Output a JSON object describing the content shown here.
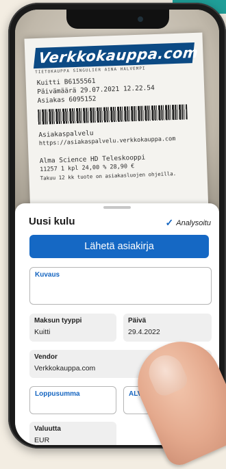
{
  "receipt": {
    "logo": "Verkkokauppa.com",
    "logo_sub": "TIETOKAUPPA SINGULIER AINA HALVEMPI",
    "lines": [
      "Kuitti        B6155561",
      "Päivämäärä    29.07.2021 12.22.54",
      "Asiakas       6095152",
      "Asiakaspalvelu",
      "https://asiakaspalvelu.verkkokauppa.com",
      "Alma Science HD Teleskooppi",
      "11257          1 kpl    24,00 %    28,90 €",
      "Takuu 12 kk    tuote on asiakasluojen ohjeilla."
    ]
  },
  "sheet": {
    "title": "Uusi kulu",
    "status": "Analysoitu",
    "send_button": "Lähetä asiakirja",
    "fields": {
      "kuvaus": {
        "label": "Kuvaus",
        "value": ""
      },
      "maksun_tyyppi": {
        "label": "Maksun tyyppi",
        "value": "Kuitti"
      },
      "paiva": {
        "label": "Päivä",
        "value": "29.4.2022"
      },
      "vendor": {
        "label": "Vendor",
        "value": "Verkkokauppa.com"
      },
      "loppusumma": {
        "label": "Loppusumma",
        "value": ""
      },
      "alv": {
        "label": "ALV",
        "value": ""
      },
      "valuutta": {
        "label": "Valuutta",
        "value": "EUR"
      }
    }
  },
  "colors": {
    "accent": "#1568c4",
    "teal": "#1f9e98",
    "background": "#f3ede2"
  }
}
